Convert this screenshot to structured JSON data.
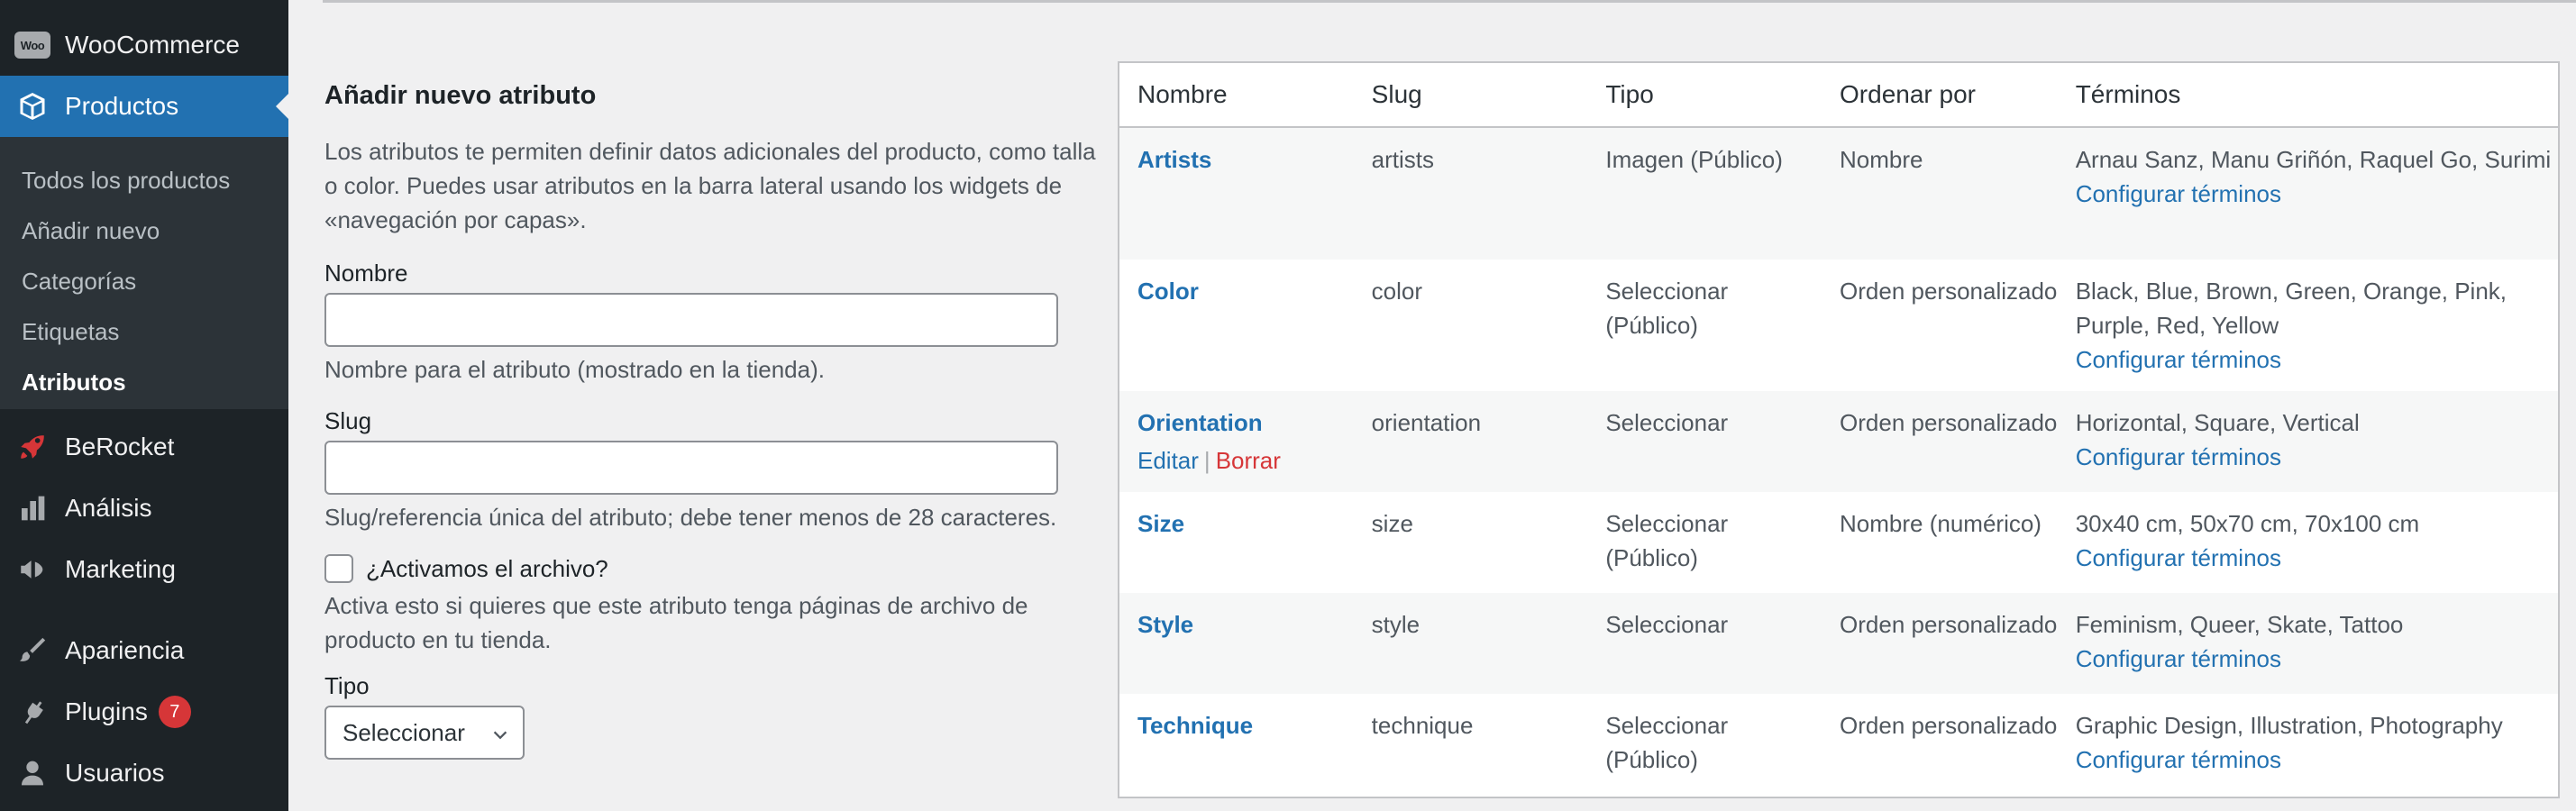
{
  "sidebar": {
    "woocommerce": {
      "label": "WooCommerce",
      "logo_text": "Woo"
    },
    "productos": {
      "label": "Productos"
    },
    "submenu": [
      {
        "label": "Todos los productos"
      },
      {
        "label": "Añadir nuevo"
      },
      {
        "label": "Categorías"
      },
      {
        "label": "Etiquetas"
      },
      {
        "label": "Atributos"
      }
    ],
    "berocket": {
      "label": "BeRocket"
    },
    "analisis": {
      "label": "Análisis"
    },
    "marketing": {
      "label": "Marketing"
    },
    "apariencia": {
      "label": "Apariencia"
    },
    "plugins": {
      "label": "Plugins",
      "badge": "7"
    },
    "usuarios": {
      "label": "Usuarios"
    }
  },
  "form": {
    "title": "Añadir nuevo atributo",
    "description": "Los atributos te permiten definir datos adicionales del producto, como talla o color. Puedes usar atributos en la barra lateral usando los widgets de «navegación por capas».",
    "nombre_label": "Nombre",
    "nombre_value": "",
    "nombre_help": "Nombre para el atributo (mostrado en la tienda).",
    "slug_label": "Slug",
    "slug_value": "",
    "slug_help": "Slug/referencia única del atributo; debe tener menos de 28 caracteres.",
    "archive_label": "¿Activamos el archivo?",
    "archive_help": "Activa esto si quieres que este atributo tenga páginas de archivo de producto en tu tienda.",
    "tipo_label": "Tipo",
    "tipo_selected": "Seleccionar"
  },
  "table": {
    "headers": [
      "Nombre",
      "Slug",
      "Tipo",
      "Ordenar por",
      "Términos"
    ],
    "configure_label": "Configurar términos",
    "edit_label": "Editar",
    "delete_label": "Borrar",
    "rows": [
      {
        "name": "Artists",
        "slug": "artists",
        "type": "Imagen (Público)",
        "order": "Nombre",
        "terms": "Arnau Sanz, Manu Griñón, Raquel Go, Surimi"
      },
      {
        "name": "Color",
        "slug": "color",
        "type": "Seleccionar (Público)",
        "order": "Orden personalizado",
        "terms": "Black, Blue, Brown, Green, Orange, Pink, Purple, Red, Yellow"
      },
      {
        "name": "Orientation",
        "slug": "orientation",
        "type": "Seleccionar",
        "order": "Orden personalizado",
        "terms": "Horizontal, Square, Vertical"
      },
      {
        "name": "Size",
        "slug": "size",
        "type": "Seleccionar (Público)",
        "order": "Nombre (numérico)",
        "terms": "30x40 cm, 50x70 cm, 70x100 cm"
      },
      {
        "name": "Style",
        "slug": "style",
        "type": "Seleccionar",
        "order": "Orden personalizado",
        "terms": "Feminism, Queer, Skate, Tattoo"
      },
      {
        "name": "Technique",
        "slug": "technique",
        "type": "Seleccionar (Público)",
        "order": "Orden personalizado",
        "terms": "Graphic Design, Illustration, Photography"
      }
    ]
  },
  "colors": {
    "sidebar_bg": "#1d2327",
    "accent": "#2271b1",
    "delete": "#d63638"
  }
}
